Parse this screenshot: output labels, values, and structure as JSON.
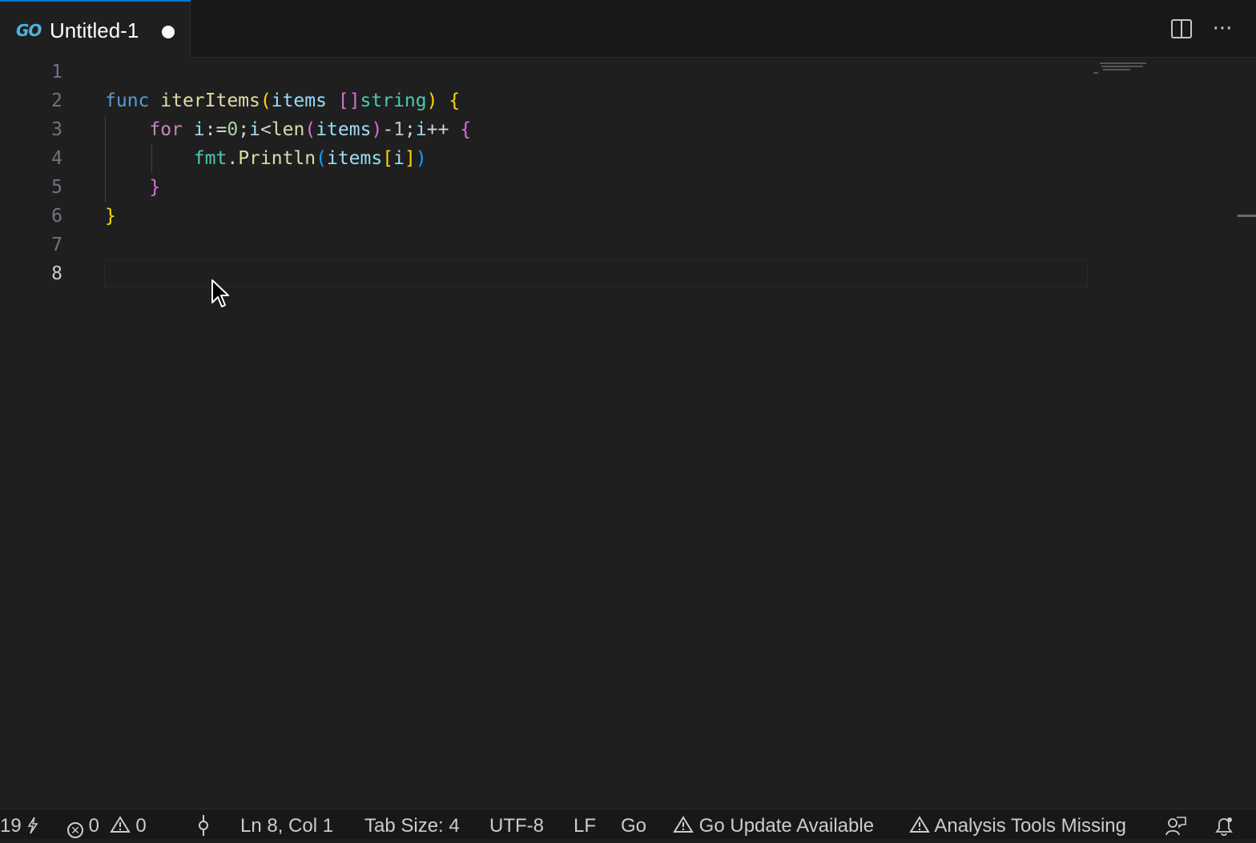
{
  "tab": {
    "label": "Untitled-1",
    "icon": "go-file-icon",
    "icon_text": "GO",
    "modified": true
  },
  "editor": {
    "line_numbers": [
      "1",
      "2",
      "3",
      "4",
      "5",
      "6",
      "7",
      "8"
    ],
    "active_line": "8",
    "lines": [
      [],
      [
        {
          "t": "func",
          "c": "kw"
        },
        {
          "t": " ",
          "c": "plain"
        },
        {
          "t": "iterItems",
          "c": "fn"
        },
        {
          "t": "(",
          "c": "b1"
        },
        {
          "t": "items",
          "c": "var"
        },
        {
          "t": " ",
          "c": "plain"
        },
        {
          "t": "[]",
          "c": "b2"
        },
        {
          "t": "string",
          "c": "type"
        },
        {
          "t": ")",
          "c": "b1"
        },
        {
          "t": " ",
          "c": "plain"
        },
        {
          "t": "{",
          "c": "b1"
        }
      ],
      [
        {
          "t": "    ",
          "c": "plain"
        },
        {
          "t": "for",
          "c": "ctl"
        },
        {
          "t": " ",
          "c": "plain"
        },
        {
          "t": "i",
          "c": "var"
        },
        {
          "t": ":=",
          "c": "op"
        },
        {
          "t": "0",
          "c": "num"
        },
        {
          "t": ";",
          "c": "plain"
        },
        {
          "t": "i",
          "c": "var"
        },
        {
          "t": "<",
          "c": "op"
        },
        {
          "t": "len",
          "c": "fn"
        },
        {
          "t": "(",
          "c": "b2"
        },
        {
          "t": "items",
          "c": "var"
        },
        {
          "t": ")",
          "c": "b2"
        },
        {
          "t": "-",
          "c": "op"
        },
        {
          "t": "1",
          "c": "num"
        },
        {
          "t": ";",
          "c": "plain"
        },
        {
          "t": "i",
          "c": "var"
        },
        {
          "t": "++",
          "c": "op"
        },
        {
          "t": " ",
          "c": "plain"
        },
        {
          "t": "{",
          "c": "b2"
        }
      ],
      [
        {
          "t": "        ",
          "c": "plain"
        },
        {
          "t": "fmt",
          "c": "type"
        },
        {
          "t": ".",
          "c": "plain"
        },
        {
          "t": "Println",
          "c": "fn"
        },
        {
          "t": "(",
          "c": "b3"
        },
        {
          "t": "items",
          "c": "var"
        },
        {
          "t": "[",
          "c": "b1"
        },
        {
          "t": "i",
          "c": "var"
        },
        {
          "t": "]",
          "c": "b1"
        },
        {
          "t": ")",
          "c": "b3"
        }
      ],
      [
        {
          "t": "    ",
          "c": "plain"
        },
        {
          "t": "}",
          "c": "b2"
        }
      ],
      [
        {
          "t": "}",
          "c": "b1"
        }
      ],
      [],
      []
    ]
  },
  "toolbar": {
    "split_icon": "split-editor-icon",
    "more_icon": "more-actions-icon",
    "more_glyph": "···"
  },
  "statusbar": {
    "left_count": "19",
    "errors": "0",
    "warnings": "0",
    "cursor_position": "Ln 8, Col 1",
    "tab_size": "Tab Size: 4",
    "encoding": "UTF-8",
    "eol": "LF",
    "language": "Go",
    "go_update": "Go Update Available",
    "analysis_tools": "Analysis Tools Missing"
  },
  "colors": {
    "tab_accent": "#0078d4",
    "keyword": "#569cd6",
    "control": "#c586c0",
    "function": "#dcdcaa",
    "variable": "#9cdcfe",
    "type": "#4ec9b0",
    "number": "#b5cea8"
  }
}
